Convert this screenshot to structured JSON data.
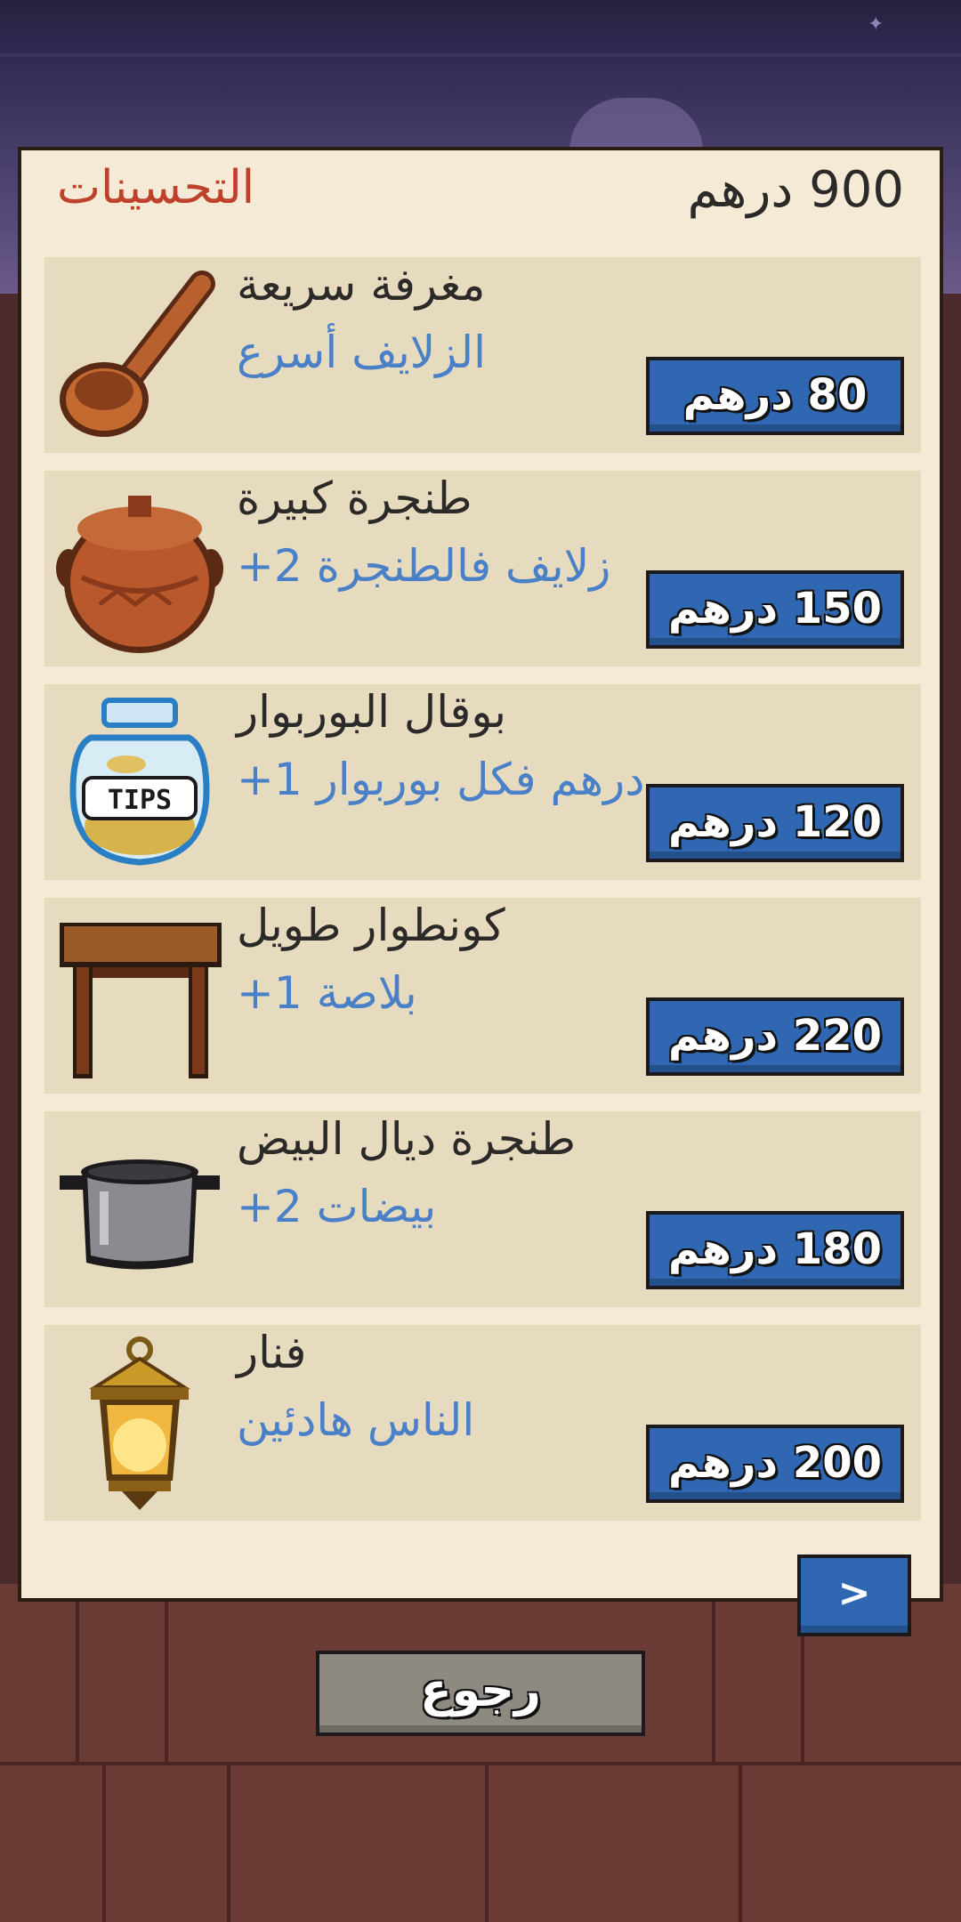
{
  "header": {
    "title": "التحسينات",
    "money": "900 درهم"
  },
  "items": [
    {
      "name": "مغرفة سريعة",
      "desc": "الزلايف أسرع",
      "price": "80 درهم",
      "icon": "ladle-icon"
    },
    {
      "name": "طنجرة كبيرة",
      "desc": "+2 زلايف فالطنجرة",
      "price": "150 درهم",
      "icon": "clay-pot-icon"
    },
    {
      "name": "بوقال البوربوار",
      "desc": "+1 درهم فكل بوربوار",
      "price": "120 درهم",
      "icon": "tips-jar-icon",
      "jar_label": "TIPS"
    },
    {
      "name": "كونطوار طويل",
      "desc": "+1 بلاصة",
      "price": "220 درهم",
      "icon": "table-icon"
    },
    {
      "name": "طنجرة ديال البيض",
      "desc": "+2 بيضات",
      "price": "180 درهم",
      "icon": "egg-pot-icon"
    },
    {
      "name": "فنار",
      "desc": "الناس هادئين",
      "price": "200 درهم",
      "icon": "lantern-icon"
    }
  ],
  "nav": {
    "next_label": ">",
    "back_label": "رجوع"
  },
  "colors": {
    "panel": "#f4ead6",
    "row": "#e6dbbf",
    "title": "#c0412b",
    "desc": "#4a80c8",
    "button": "#2f67b3",
    "back_button": "#8e8a82"
  }
}
